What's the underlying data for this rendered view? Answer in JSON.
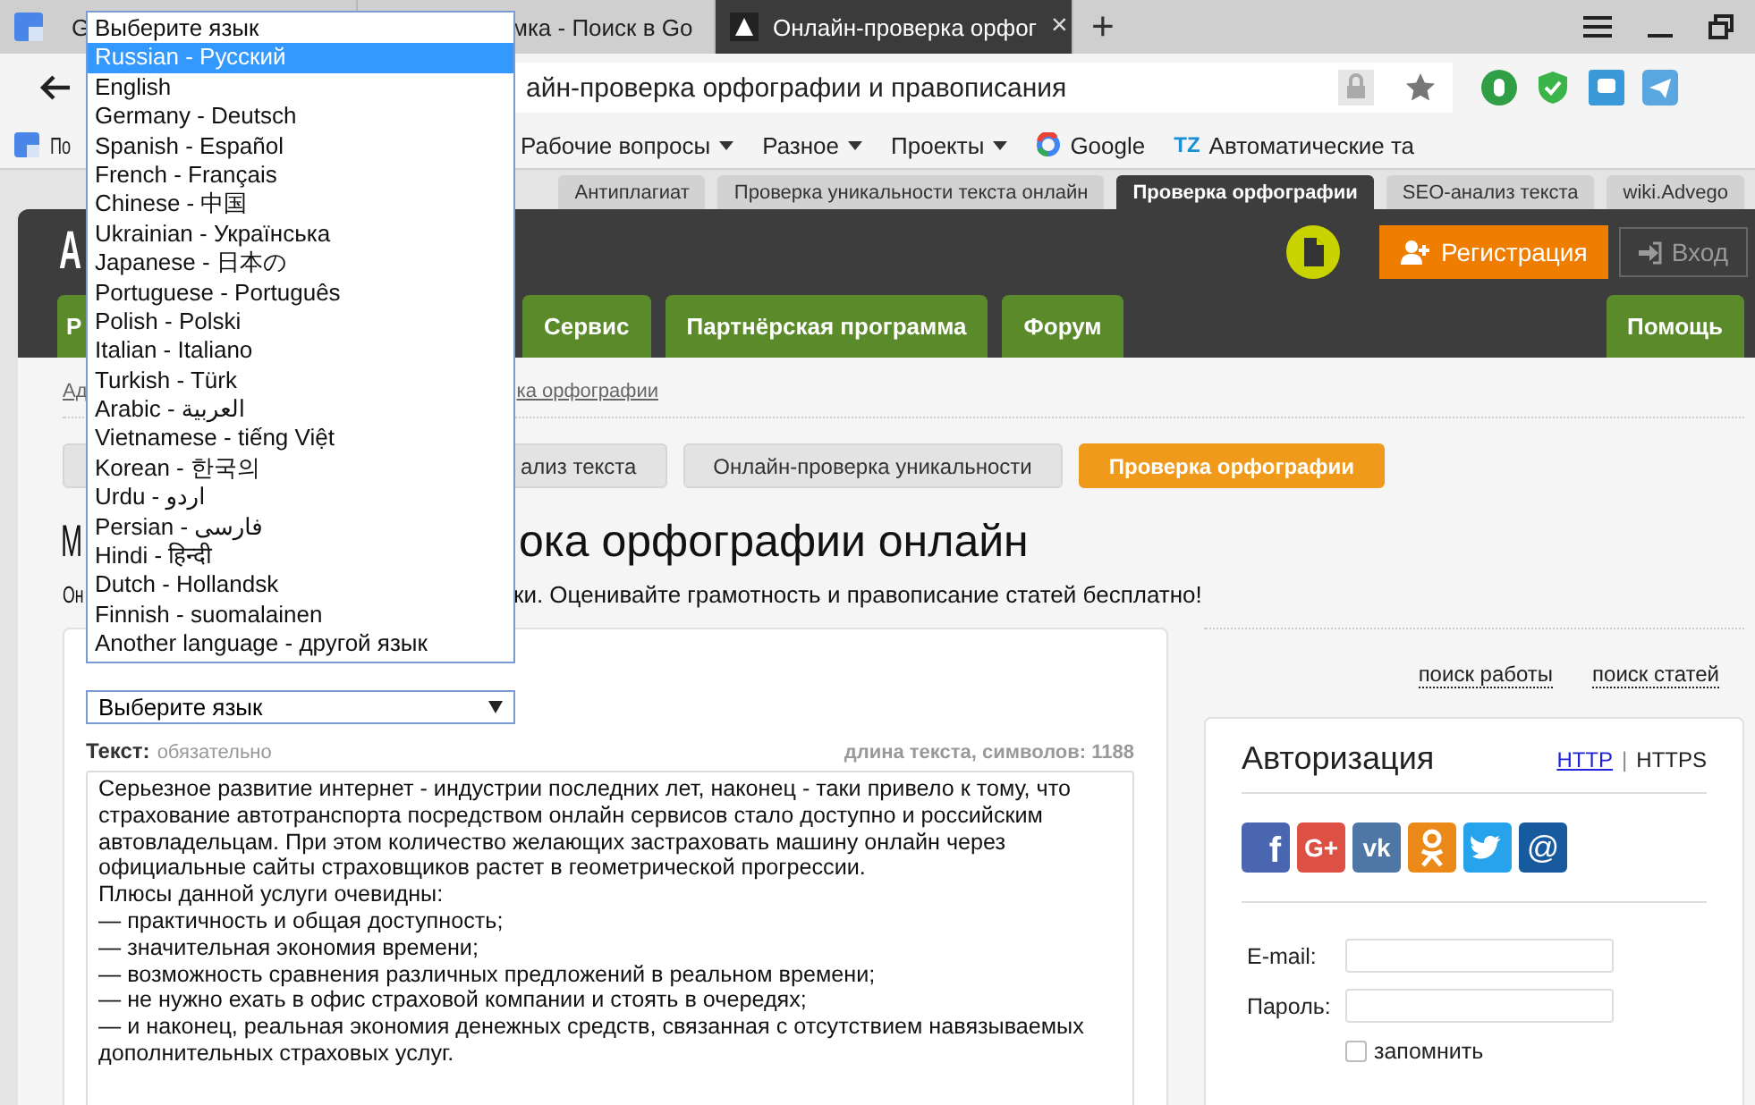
{
  "browser": {
    "tabs": [
      {
        "title": "G",
        "selected": false
      },
      {
        "title": "мка - Поиск в Go",
        "selected": false
      },
      {
        "title": "Онлайн-проверка орфог",
        "selected": true
      }
    ],
    "close_glyph": "×",
    "new_tab": "+",
    "address": "айн-проверка орфографии и правописания",
    "bookmarks": [
      {
        "label": "По",
        "kind": "page"
      },
      {
        "label": "Рабочие вопросы",
        "kind": "folder"
      },
      {
        "label": "Разное",
        "kind": "folder"
      },
      {
        "label": "Проекты",
        "kind": "folder"
      },
      {
        "label": "Google",
        "kind": "google"
      },
      {
        "label": "Автоматические та",
        "kind": "tz",
        "badge": "TZ"
      }
    ]
  },
  "site_tabs": [
    {
      "label": "Антиплагиат",
      "selected": false
    },
    {
      "label": "Проверка уникальности текста онлайн",
      "selected": false
    },
    {
      "label": "Проверка орфографии",
      "selected": true
    },
    {
      "label": "SEO-анализ текста",
      "selected": false
    },
    {
      "label": "wiki.Advego",
      "selected": false
    }
  ],
  "header": {
    "logo": "A",
    "register": "Регистрация",
    "login": "Вход",
    "nav": [
      {
        "label": "Р"
      },
      {
        "label": "Сервис"
      },
      {
        "label": "Партнёрская программа"
      },
      {
        "label": "Форум"
      }
    ],
    "help": "Помощь"
  },
  "breadcrumbs": [
    "Ад",
    "ка орфографии"
  ],
  "subnav": [
    {
      "label": "ализ текста",
      "selected": false
    },
    {
      "label": "Онлайн-проверка уникальности",
      "selected": false
    },
    {
      "label": "Проверка орфографии",
      "selected": true
    }
  ],
  "heading": [
    "М",
    "ока орфографии онлайн"
  ],
  "subtitle": [
    "Он",
    "ки. Оценивайте грамотность и правописание статей бесплатно!"
  ],
  "form": {
    "language_select": "Выберите язык",
    "text_label": "Текст:",
    "text_hint": "обязательно",
    "length": "длина текста, символов: 1188",
    "text_lines": [
      "Серьезное развитие интернет - индустрии последних лет, наконец - таки привело к тому, что",
      "страхование автотранспорта посредством онлайн сервисов стало доступно и российским",
      "автовладельцам. При этом количество желающих застраховать машину онлайн через",
      "официальные сайты страховщиков растет в геометрической прогрессии.",
      "Плюсы данной услуги очевидны:",
      "— практичность и общая доступность;",
      "— значительная экономия времени;",
      "— возможность сравнения различных предложений в реальном времени;",
      "— не нужно ехать в офис страховой компании и стоять в очередях;",
      "— и наконец, реальная экономия денежных средств, связанная с отсутствием навязываемых",
      "дополнительных страховых услуг."
    ]
  },
  "language_options": [
    {
      "label": "Выберите язык",
      "selected": false
    },
    {
      "label": "Russian - Русский",
      "selected": true
    },
    {
      "label": "English",
      "selected": false
    },
    {
      "label": "Germany - Deutsch",
      "selected": false
    },
    {
      "label": "Spanish - Español",
      "selected": false
    },
    {
      "label": "French - Français",
      "selected": false
    },
    {
      "label": "Chinese - 中国",
      "selected": false
    },
    {
      "label": "Ukrainian - Українська",
      "selected": false
    },
    {
      "label": "Japanese - 日本の",
      "selected": false
    },
    {
      "label": "Portuguese - Português",
      "selected": false
    },
    {
      "label": "Polish - Polski",
      "selected": false
    },
    {
      "label": "Italian - Italiano",
      "selected": false
    },
    {
      "label": "Turkish - Türk",
      "selected": false
    },
    {
      "label": "Arabic - العربية",
      "selected": false
    },
    {
      "label": "Vietnamese - tiếng Việt",
      "selected": false
    },
    {
      "label": "Korean - 한국의",
      "selected": false
    },
    {
      "label": "Urdu - اردو",
      "selected": false
    },
    {
      "label": "Persian - فارسی",
      "selected": false
    },
    {
      "label": "Hindi - हिन्दी",
      "selected": false
    },
    {
      "label": "Dutch - Hollandsk",
      "selected": false
    },
    {
      "label": "Finnish - suomalainen",
      "selected": false
    },
    {
      "label": "Another language - другой язык",
      "selected": false
    }
  ],
  "side_links": [
    "поиск работы",
    "поиск статей"
  ],
  "auth": {
    "title": "Авторизация",
    "protocols": [
      {
        "label": "HTTP",
        "selected": false
      },
      {
        "label": "HTTPS",
        "selected": true
      }
    ],
    "separator": "|",
    "socials": [
      {
        "kind": "facebook",
        "glyph": "f"
      },
      {
        "kind": "google",
        "glyph": "G+"
      },
      {
        "kind": "vk",
        "glyph": "vk"
      },
      {
        "kind": "ok"
      },
      {
        "kind": "twitter"
      },
      {
        "kind": "mail",
        "glyph": "@"
      }
    ],
    "email_label": "E-mail:",
    "password_label": "Пароль:",
    "remember": {
      "label": "запомнить",
      "checked": false
    }
  }
}
